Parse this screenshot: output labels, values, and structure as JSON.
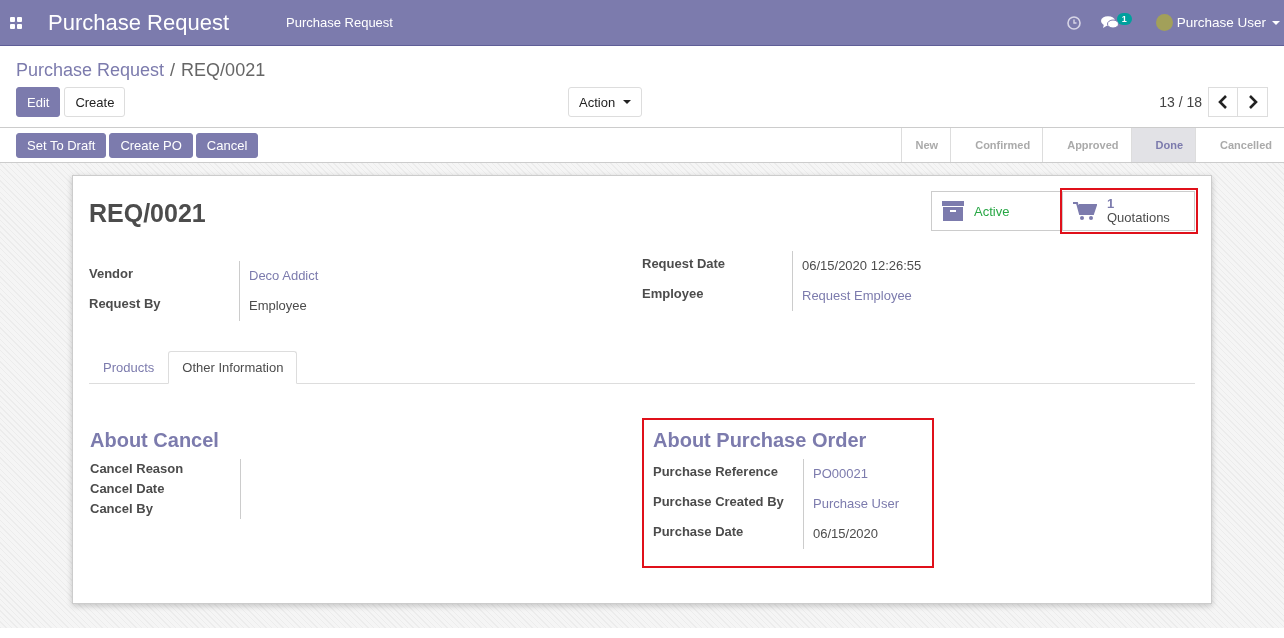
{
  "navbar": {
    "app_title": "Purchase Request",
    "menu": [
      "Purchase Request"
    ],
    "messages_badge": "1",
    "user": "Purchase User"
  },
  "breadcrumb": {
    "parent": "Purchase Request",
    "separator": "/",
    "current": "REQ/0021"
  },
  "control_buttons": [
    {
      "label": "Edit",
      "kind": "primary"
    },
    {
      "label": "Create",
      "kind": "secondary"
    }
  ],
  "action": "Action",
  "pager": "13 / 18",
  "header_buttons": [
    "Set To Draft",
    "Create PO",
    "Cancel"
  ],
  "statusbar": [
    {
      "label": "New",
      "selected": false
    },
    {
      "label": "Confirmed",
      "selected": false
    },
    {
      "label": "Approved",
      "selected": false
    },
    {
      "label": "Done",
      "selected": true
    },
    {
      "label": "Cancelled",
      "selected": false
    }
  ],
  "record": {
    "title": "REQ/0021",
    "stat_buttons": [
      {
        "kind": "archive",
        "label": "Active",
        "highlighted": false
      },
      {
        "kind": "cart",
        "value": "1",
        "label": "Quotations",
        "highlighted": true
      }
    ],
    "left_fields": [
      {
        "label": "Vendor",
        "value": "Deco Addict",
        "kind": "link"
      },
      {
        "label": "Request By",
        "value": "Employee",
        "kind": "text"
      }
    ],
    "right_fields": [
      {
        "label": "Request Date",
        "value": "06/15/2020 12:26:55",
        "kind": "text"
      },
      {
        "label": "Employee",
        "value": "Request Employee",
        "kind": "link"
      }
    ]
  },
  "tabs": [
    {
      "label": "Products",
      "selected": false
    },
    {
      "label": "Other Information",
      "selected": true
    }
  ],
  "sections": [
    {
      "title": "About Cancel",
      "highlighted": false,
      "fields": [
        {
          "label": "Cancel Reason"
        },
        {
          "label": "Cancel Date"
        },
        {
          "label": "Cancel By"
        }
      ]
    },
    {
      "title": "About Purchase Order",
      "highlighted": true,
      "fields": [
        {
          "label": "Purchase Reference",
          "value": "PO00021",
          "kind": "link"
        },
        {
          "label": "Purchase Created By",
          "value": "Purchase User",
          "kind": "link"
        },
        {
          "label": "Purchase Date",
          "value": "06/15/2020",
          "kind": "text"
        }
      ]
    }
  ]
}
